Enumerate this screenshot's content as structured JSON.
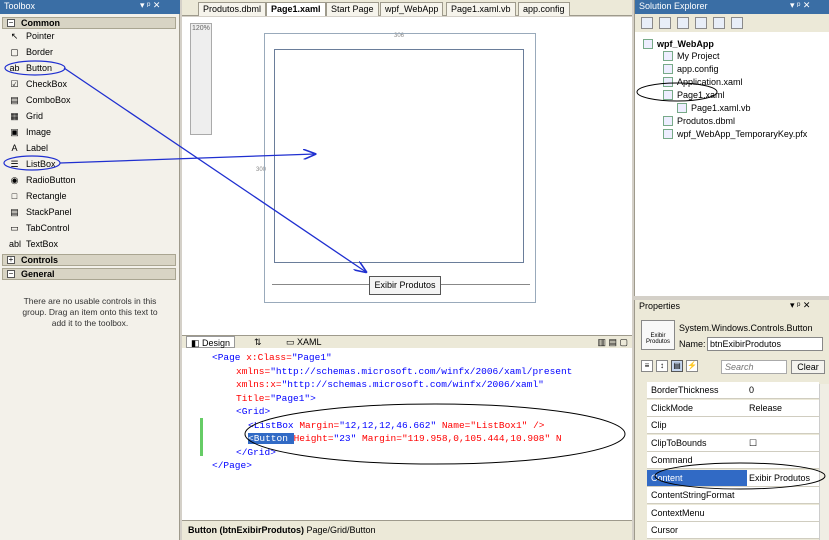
{
  "toolbox": {
    "title": "Toolbox",
    "title_buttons": "▾ ᵖ ✕",
    "common_group": "Common",
    "items": [
      {
        "label": "Pointer",
        "icon": "↖"
      },
      {
        "label": "Border",
        "icon": "▢"
      },
      {
        "label": "Button",
        "icon": "ab"
      },
      {
        "label": "CheckBox",
        "icon": "☑"
      },
      {
        "label": "ComboBox",
        "icon": "▤"
      },
      {
        "label": "Grid",
        "icon": "▦"
      },
      {
        "label": "Image",
        "icon": "▣"
      },
      {
        "label": "Label",
        "icon": "A"
      },
      {
        "label": "ListBox",
        "icon": "☰"
      },
      {
        "label": "RadioButton",
        "icon": "◉"
      },
      {
        "label": "Rectangle",
        "icon": "□"
      },
      {
        "label": "StackPanel",
        "icon": "▤"
      },
      {
        "label": "TabControl",
        "icon": "▭"
      },
      {
        "label": "TextBox",
        "icon": "abl"
      }
    ],
    "controls_group": "Controls",
    "general_group": "General",
    "empty_text": "There are no usable controls in this group. Drag an item onto this text to add it to the toolbox."
  },
  "tabs": [
    {
      "label": "Produtos.dbml",
      "active": false
    },
    {
      "label": "Page1.xaml",
      "active": true
    },
    {
      "label": "Start Page",
      "active": false
    },
    {
      "label": "wpf_WebApp",
      "active": false
    },
    {
      "label": "Page1.xaml.vb",
      "active": false
    },
    {
      "label": "app.config",
      "active": false
    }
  ],
  "designer": {
    "zoom_label": "120%",
    "width_dim": "306",
    "height_dim": "300",
    "button_text": "Exibir Produtos"
  },
  "views": {
    "design": "Design",
    "swap": "⇅",
    "xaml": "XAML"
  },
  "xaml_lines": [
    {
      "tag": "<Page ",
      "attr": "x:Class=",
      "val": "\"Page1\"",
      "rest": ""
    },
    {
      "tag": "",
      "attr": "xmlns=",
      "val": "\"http://schemas.microsoft.com/winfx/2006/xaml/present",
      "rest": ""
    },
    {
      "tag": "",
      "attr": "xmlns:x=",
      "val": "\"http://schemas.microsoft.com/winfx/2006/xaml\"",
      "rest": ""
    },
    {
      "tag": "",
      "attr": "Title=",
      "val": "\"Page1\">",
      "rest": ""
    },
    {
      "tag": "<Grid>",
      "attr": "",
      "val": "",
      "rest": ""
    },
    {
      "tag": "<ListBox ",
      "attr": "Margin=",
      "val": "\"12,12,12,46.662\"",
      "rest": " Name=\"ListBox1\" />"
    },
    {
      "tag": "<Button ",
      "attr": "Height=",
      "val": "\"23\"",
      "rest": " Margin=\"119.958,0,105.444,10.908\" N"
    },
    {
      "tag": "</Grid>",
      "attr": "",
      "val": "",
      "rest": ""
    },
    {
      "tag": "</Page>",
      "attr": "",
      "val": "",
      "rest": ""
    }
  ],
  "status": {
    "element": "Button (btnExibirProdutos)",
    "path": "Page/Grid/Button"
  },
  "solution": {
    "title": "Solution Explorer",
    "title_buttons": "▾ ᵖ ✕",
    "project": "wpf_WebApp",
    "items": [
      "My Project",
      "app.config",
      "Application.xaml",
      "Page1.xaml",
      "Page1.xaml.vb",
      "Produtos.dbml",
      "wpf_WebApp_TemporaryKey.pfx"
    ]
  },
  "properties": {
    "title": "Properties",
    "title_buttons": "▾ ᵖ ✕",
    "type": "System.Windows.Controls.Button",
    "name_label": "Name:",
    "name_value": "btnExibirProdutos",
    "thumb_text": "Exibir Produtos",
    "search_placeholder": "Search",
    "clear": "Clear",
    "rows": [
      {
        "name": "BorderThickness",
        "value": "0"
      },
      {
        "name": "ClickMode",
        "value": "Release"
      },
      {
        "name": "Clip",
        "value": ""
      },
      {
        "name": "ClipToBounds",
        "value": "☐"
      },
      {
        "name": "Command",
        "value": ""
      },
      {
        "name": "Content",
        "value": "Exibir Produtos"
      },
      {
        "name": "ContentStringFormat",
        "value": ""
      },
      {
        "name": "ContextMenu",
        "value": ""
      },
      {
        "name": "Cursor",
        "value": ""
      }
    ]
  },
  "colors": {
    "title_bar": "#3a6ea5",
    "annotation": "#1f2fd0",
    "selection": "#316ac5"
  }
}
